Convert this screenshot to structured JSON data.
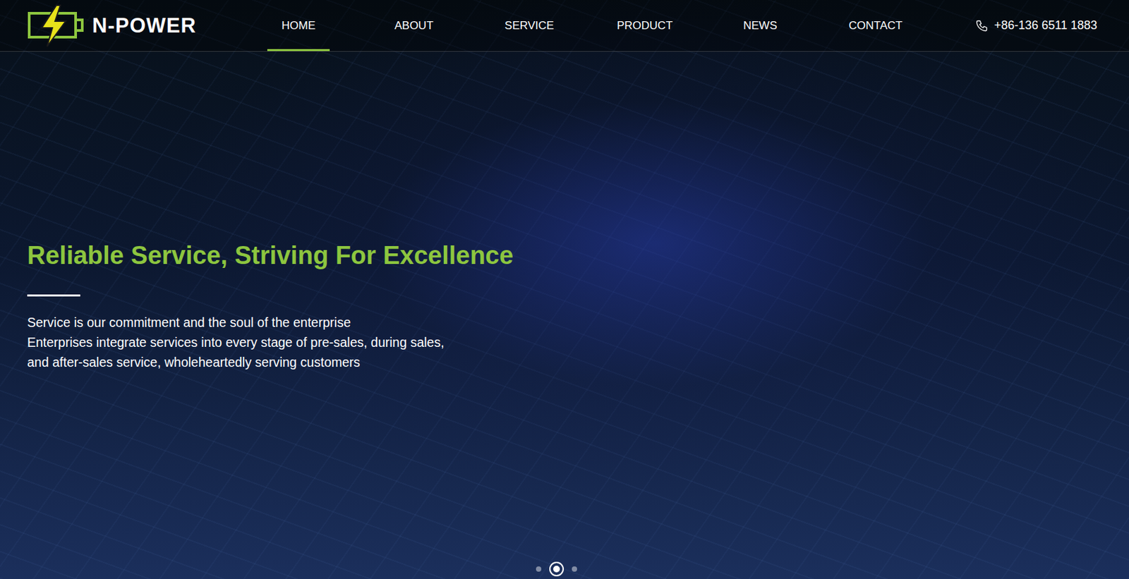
{
  "header": {
    "logo": "N-POWER",
    "nav": [
      {
        "label": "HOME",
        "selected": true
      },
      {
        "label": "ABOUT",
        "selected": false
      },
      {
        "label": "SERVICE",
        "selected": false
      },
      {
        "label": "PRODUCT",
        "selected": false
      },
      {
        "label": "NEWS",
        "selected": false
      },
      {
        "label": "CONTACT",
        "selected": false
      }
    ],
    "phone": "+86-136 6511 1883"
  },
  "hero": {
    "title": "Reliable Service, Striving For Excellence",
    "lines": [
      "Service is our commitment and the soul of the enterprise",
      "Enterprises integrate services into every stage of pre-sales, during sales,",
      "and after-sales service, wholeheartedly serving customers"
    ],
    "slides": [
      {
        "selected": false
      },
      {
        "selected": true
      },
      {
        "selected": false
      }
    ]
  }
}
